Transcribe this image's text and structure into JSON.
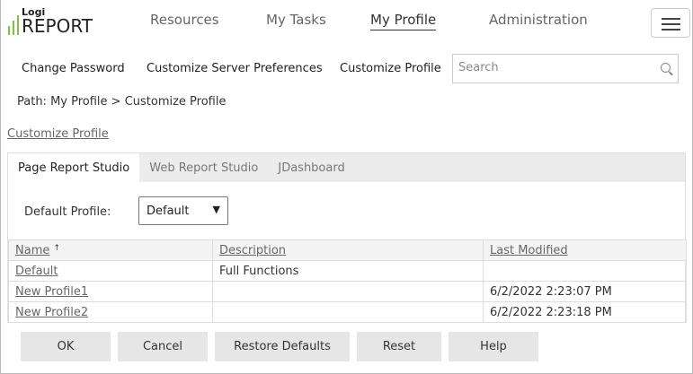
{
  "logo": {
    "top": "Logi",
    "main": "REPORT"
  },
  "nav": [
    "Resources",
    "My Tasks",
    "My Profile",
    "Administration"
  ],
  "subnav": [
    "Change Password",
    "Customize Server Preferences",
    "Customize Profile"
  ],
  "search": {
    "placeholder": "Search"
  },
  "path": "Path: My Profile > Customize Profile",
  "page_link": "Customize Profile",
  "tabs": [
    "Page Report Studio",
    "Web Report Studio",
    "JDashboard"
  ],
  "default_profile": {
    "label": "Default Profile:",
    "value": "Default"
  },
  "table": {
    "headers": [
      "Name",
      "Description",
      "Last Modified"
    ],
    "sort_indicator": "↑",
    "rows": [
      [
        "Default",
        "Full Functions",
        ""
      ],
      [
        "New Profile1",
        "",
        "6/2/2022 2:23:07 PM"
      ],
      [
        "New Profile2",
        "",
        "6/2/2022 2:23:18 PM"
      ]
    ]
  },
  "buttons": [
    "OK",
    "Cancel",
    "Restore Defaults",
    "Reset",
    "Help"
  ]
}
